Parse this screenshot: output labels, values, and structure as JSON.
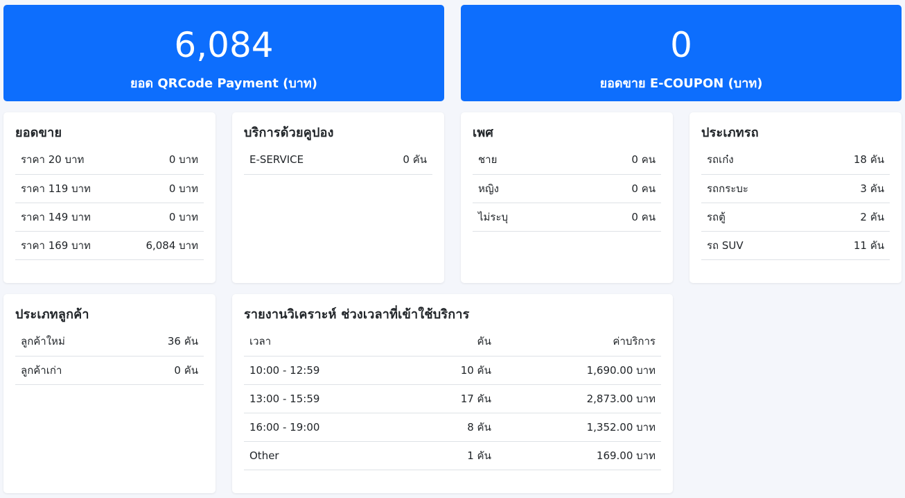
{
  "qr": {
    "value": "6,084",
    "label": "ยอด QRCode Payment (บาท)"
  },
  "ecoupon": {
    "value": "0",
    "label": "ยอดขาย E-COUPON (บาท)"
  },
  "sales": {
    "title": "ยอดขาย",
    "rows": [
      {
        "label": "ราคา 20 บาท",
        "value": "0 บาท"
      },
      {
        "label": "ราคา 119 บาท",
        "value": "0 บาท"
      },
      {
        "label": "ราคา 149 บาท",
        "value": "0 บาท"
      },
      {
        "label": "ราคา 169 บาท",
        "value": "6,084 บาท"
      }
    ]
  },
  "coupon": {
    "title": "บริการด้วยคูปอง",
    "rows": [
      {
        "label": "E-SERVICE",
        "value": "0 คัน"
      }
    ]
  },
  "gender": {
    "title": "เพศ",
    "rows": [
      {
        "label": "ชาย",
        "value": "0 คน"
      },
      {
        "label": "หญิง",
        "value": "0 คน"
      },
      {
        "label": "ไม่ระบุ",
        "value": "0 คน"
      }
    ]
  },
  "cartype": {
    "title": "ประเภทรถ",
    "rows": [
      {
        "label": "รถเก๋ง",
        "value": "18 คัน"
      },
      {
        "label": "รถกระบะ",
        "value": "3 คัน"
      },
      {
        "label": "รถตู้",
        "value": "2 คัน"
      },
      {
        "label": "รถ SUV",
        "value": "11 คัน"
      }
    ]
  },
  "custtype": {
    "title": "ประเภทลูกค้า",
    "rows": [
      {
        "label": "ลูกค้าใหม่",
        "value": "36 คัน"
      },
      {
        "label": "ลูกค้าเก่า",
        "value": "0 คัน"
      }
    ]
  },
  "report": {
    "title": "รายงานวิเคราะห์ ช่วงเวลาที่เข้าใช้บริการ",
    "headers": {
      "time": "เวลา",
      "cars": "คัน",
      "fee": "ค่าบริการ"
    },
    "rows": [
      {
        "time": "10:00 - 12:59",
        "cars": "10 คัน",
        "fee": "1,690.00 บาท"
      },
      {
        "time": "13:00 - 15:59",
        "cars": "17 คัน",
        "fee": "2,873.00 บาท"
      },
      {
        "time": "16:00 - 19:00",
        "cars": "8 คัน",
        "fee": "1,352.00 บาท"
      },
      {
        "time": "Other",
        "cars": "1 คัน",
        "fee": "169.00 บาท"
      }
    ]
  }
}
